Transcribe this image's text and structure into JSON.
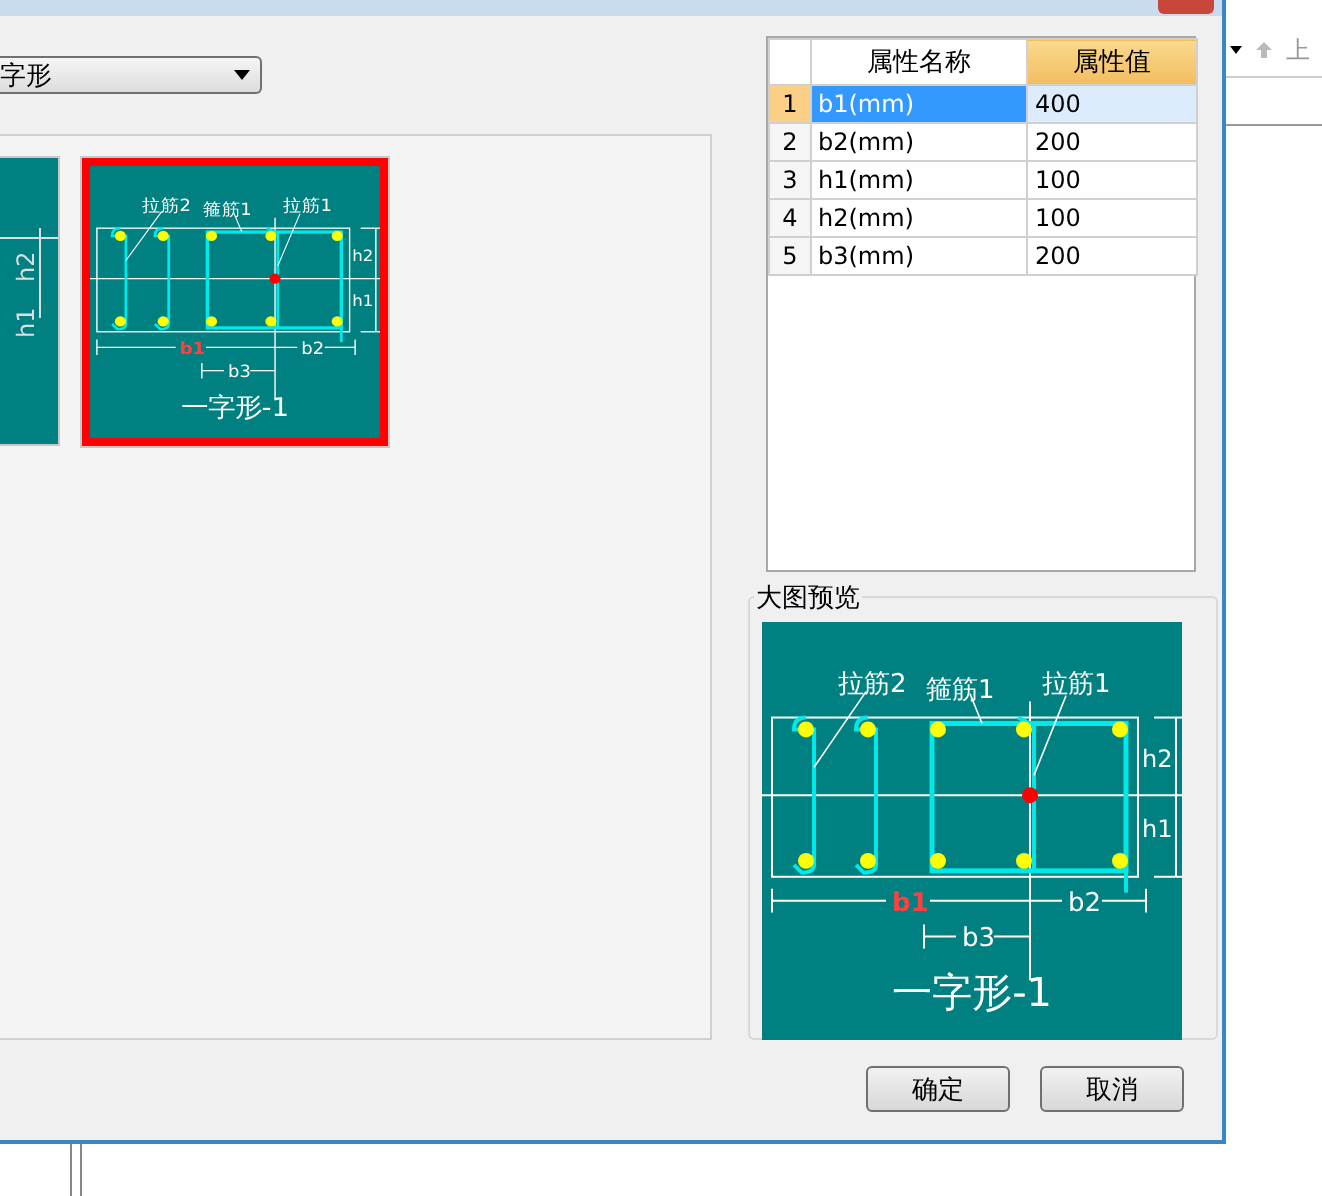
{
  "dropdown": {
    "value": "字形"
  },
  "thumbnails": [
    {
      "kind": "partial",
      "selected": false,
      "labels": {
        "h1": "h1",
        "h2": "h2"
      }
    },
    {
      "kind": "full",
      "selected": true,
      "labels": {
        "tie2": "拉筋2",
        "stirrup": "箍筋1",
        "tie1": "拉筋1",
        "b1": "b1",
        "b2": "b2",
        "b3": "b3",
        "h1": "h1",
        "h2": "h2",
        "caption": "一字形-1"
      }
    }
  ],
  "property_grid": {
    "columns": [
      "属性名称",
      "属性值"
    ],
    "rows": [
      {
        "index": "1",
        "name": "b1(mm)",
        "value": "400",
        "selected": true
      },
      {
        "index": "2",
        "name": "b2(mm)",
        "value": "200",
        "selected": false
      },
      {
        "index": "3",
        "name": "h1(mm)",
        "value": "100",
        "selected": false
      },
      {
        "index": "4",
        "name": "h2(mm)",
        "value": "100",
        "selected": false
      },
      {
        "index": "5",
        "name": "b3(mm)",
        "value": "200",
        "selected": false
      }
    ]
  },
  "preview": {
    "title": "大图预览",
    "labels": {
      "tie2": "拉筋2",
      "stirrup": "箍筋1",
      "tie1": "拉筋1",
      "b1": "b1",
      "b2": "b2",
      "b3": "b3",
      "h1": "h1",
      "h2": "h2",
      "caption": "一字形-1"
    }
  },
  "buttons": [
    "确定",
    "取消"
  ],
  "background_toolbar": {
    "text": "上"
  }
}
